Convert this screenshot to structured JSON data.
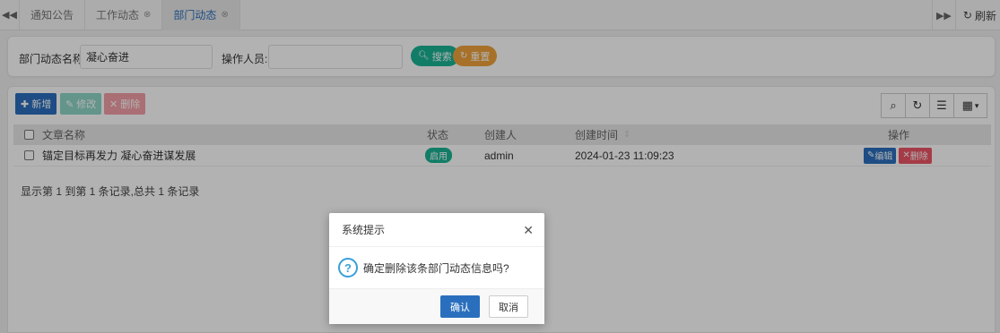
{
  "tabs": [
    {
      "label": "通知公告",
      "closable": false
    },
    {
      "label": "工作动态",
      "closable": true
    },
    {
      "label": "部门动态",
      "closable": true,
      "active": true
    }
  ],
  "tabbar": {
    "refresh_label": "刷新"
  },
  "search": {
    "name_label": "部门动态名称:",
    "name_value": "凝心奋进",
    "operator_label": "操作人员:",
    "operator_value": "",
    "search_btn": "搜索",
    "reset_btn": "重置"
  },
  "toolbar": {
    "add": "新增",
    "edit": "修改",
    "delete": "删除"
  },
  "table": {
    "headers": {
      "title": "文章名称",
      "status": "状态",
      "creator": "创建人",
      "created_at": "创建时间",
      "actions": "操作"
    },
    "rows": [
      {
        "title": "锚定目标再发力 凝心奋进谋发展",
        "status": "启用",
        "creator": "admin",
        "created_at": "2024-01-23 11:09:23",
        "edit": "编辑",
        "delete": "删除"
      }
    ]
  },
  "pagination": {
    "summary": "显示第 1 到第 1 条记录,总共 1 条记录"
  },
  "dialog": {
    "title": "系统提示",
    "message": "确定删除该条部门动态信息吗?",
    "confirm": "确认",
    "cancel": "取消"
  },
  "colors": {
    "primary": "#2a6fbd",
    "success": "#1ab394",
    "warning": "#f0a33b",
    "danger": "#ed5565",
    "info": "#3aa0d8"
  }
}
